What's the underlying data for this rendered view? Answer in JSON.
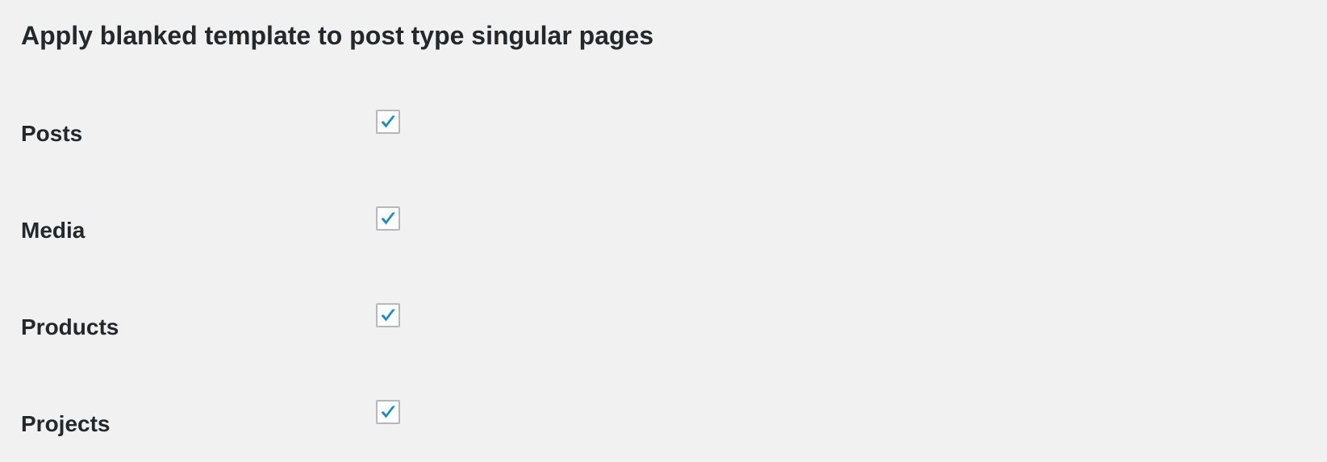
{
  "section": {
    "title": "Apply blanked template to post type singular pages"
  },
  "post_types": [
    {
      "label": "Posts",
      "checked": true
    },
    {
      "label": "Media",
      "checked": true
    },
    {
      "label": "Products",
      "checked": true
    },
    {
      "label": "Projects",
      "checked": true
    }
  ],
  "colors": {
    "background": "#f1f1f1",
    "text": "#23282d",
    "checkmark": "#1e8cbe",
    "checkbox_border": "#b4b9be"
  },
  "icons": {
    "checkbox_checked": "checkmark-icon"
  }
}
